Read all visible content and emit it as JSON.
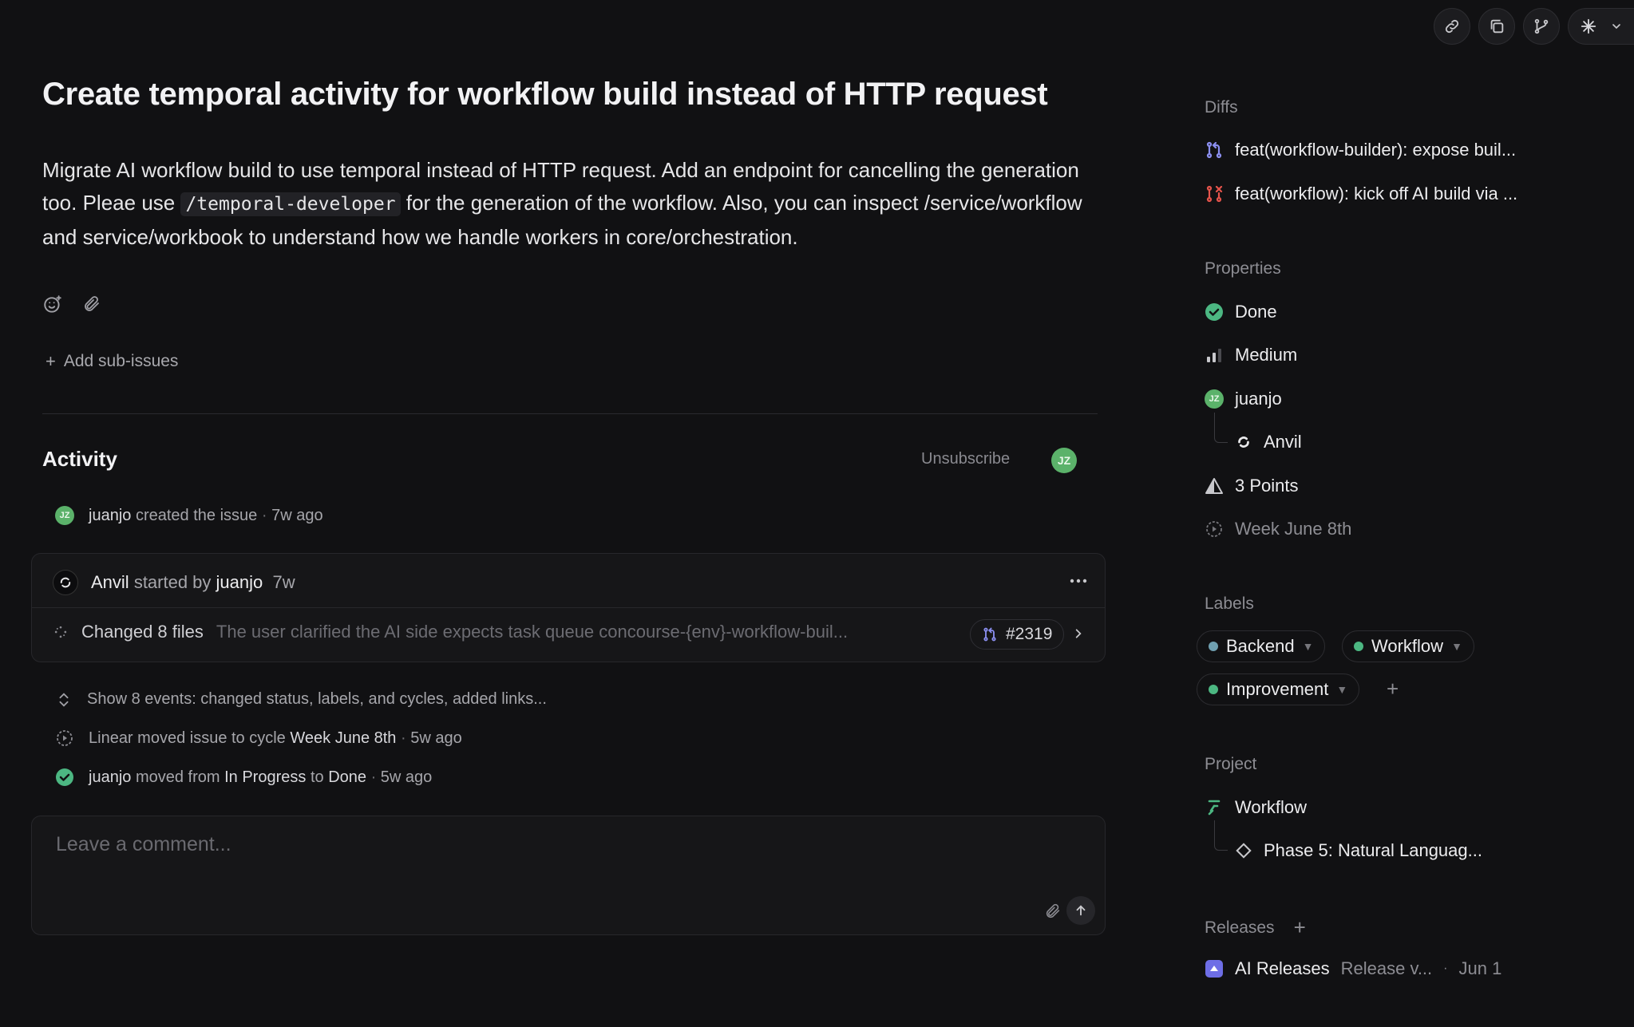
{
  "issue": {
    "title": "Create temporal activity for workflow build instead of HTTP request",
    "description_parts": [
      "Migrate AI workflow build to use temporal instead of HTTP request. Add an endpoint for cancelling the generation too. Pleae use ",
      "/temporal-developer",
      " for the generation of the workflow. Also, you can inspect /service/workflow and service/workbook to understand how we handle workers in core/orchestration."
    ],
    "add_sub_issues": "Add sub-issues"
  },
  "activity": {
    "title": "Activity",
    "unsubscribe": "Unsubscribe",
    "avatar_initials": "JZ",
    "created": {
      "user": "juanjo",
      "action": "created the issue",
      "time": "7w ago"
    },
    "agent_card": {
      "agent": "Anvil",
      "started_by": "started by",
      "user": "juanjo",
      "time": "7w",
      "changed_files": "Changed 8 files",
      "summary": "The user clarified the AI side expects task queue concourse-{env}-workflow-buil...",
      "pr_number": "#2319"
    },
    "show_events": "Show 8 events: changed status, labels, and cycles, added links...",
    "cycle_event": {
      "actor": "Linear",
      "action": "moved issue to cycle",
      "target": "Week June 8th",
      "time": "5w ago"
    },
    "status_event": {
      "actor": "juanjo",
      "action_1": "moved from",
      "from": "In Progress",
      "action_2": "to",
      "to": "Done",
      "time": "5w ago"
    },
    "comment_placeholder": "Leave a comment..."
  },
  "sidebar": {
    "diffs_label": "Diffs",
    "diffs": [
      {
        "title": "feat(workflow-builder): expose buil...",
        "color": "#8b8ff0"
      },
      {
        "title": "feat(workflow): kick off AI build via ...",
        "color": "#e5534b"
      }
    ],
    "properties_label": "Properties",
    "status": "Done",
    "priority": "Medium",
    "assignee": "juanjo",
    "assignee_initials": "JZ",
    "delegate": "Anvil",
    "estimate": "3 Points",
    "cycle": "Week June 8th",
    "labels_label": "Labels",
    "labels": [
      {
        "name": "Backend",
        "color": "#6f9fb0"
      },
      {
        "name": "Workflow",
        "color": "#4cb782"
      },
      {
        "name": "Improvement",
        "color": "#4cb782"
      }
    ],
    "project_label": "Project",
    "project": "Workflow",
    "milestone": "Phase 5: Natural Languag...",
    "releases_label": "Releases",
    "release": {
      "name": "AI Releases",
      "version": "Release v...",
      "date": "Jun 1"
    }
  },
  "colors": {
    "background": "#111113",
    "done_green": "#4cb782",
    "release_purple": "#6e6ee6"
  }
}
